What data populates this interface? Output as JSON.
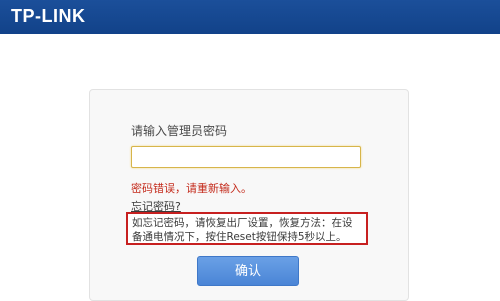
{
  "header": {
    "brand": "TP-LINK",
    "bg_color": "#134590"
  },
  "login": {
    "prompt": "请输入管理员密码",
    "password_value": "",
    "error_text": "密码错误，请重新输入。",
    "forgot_link": "忘记密码?",
    "hint_text": "如忘记密码，请恢复出厂设置，恢复方法：在设备通电情况下，按住Reset按钮保持5秒以上。",
    "confirm_label": "确认"
  }
}
